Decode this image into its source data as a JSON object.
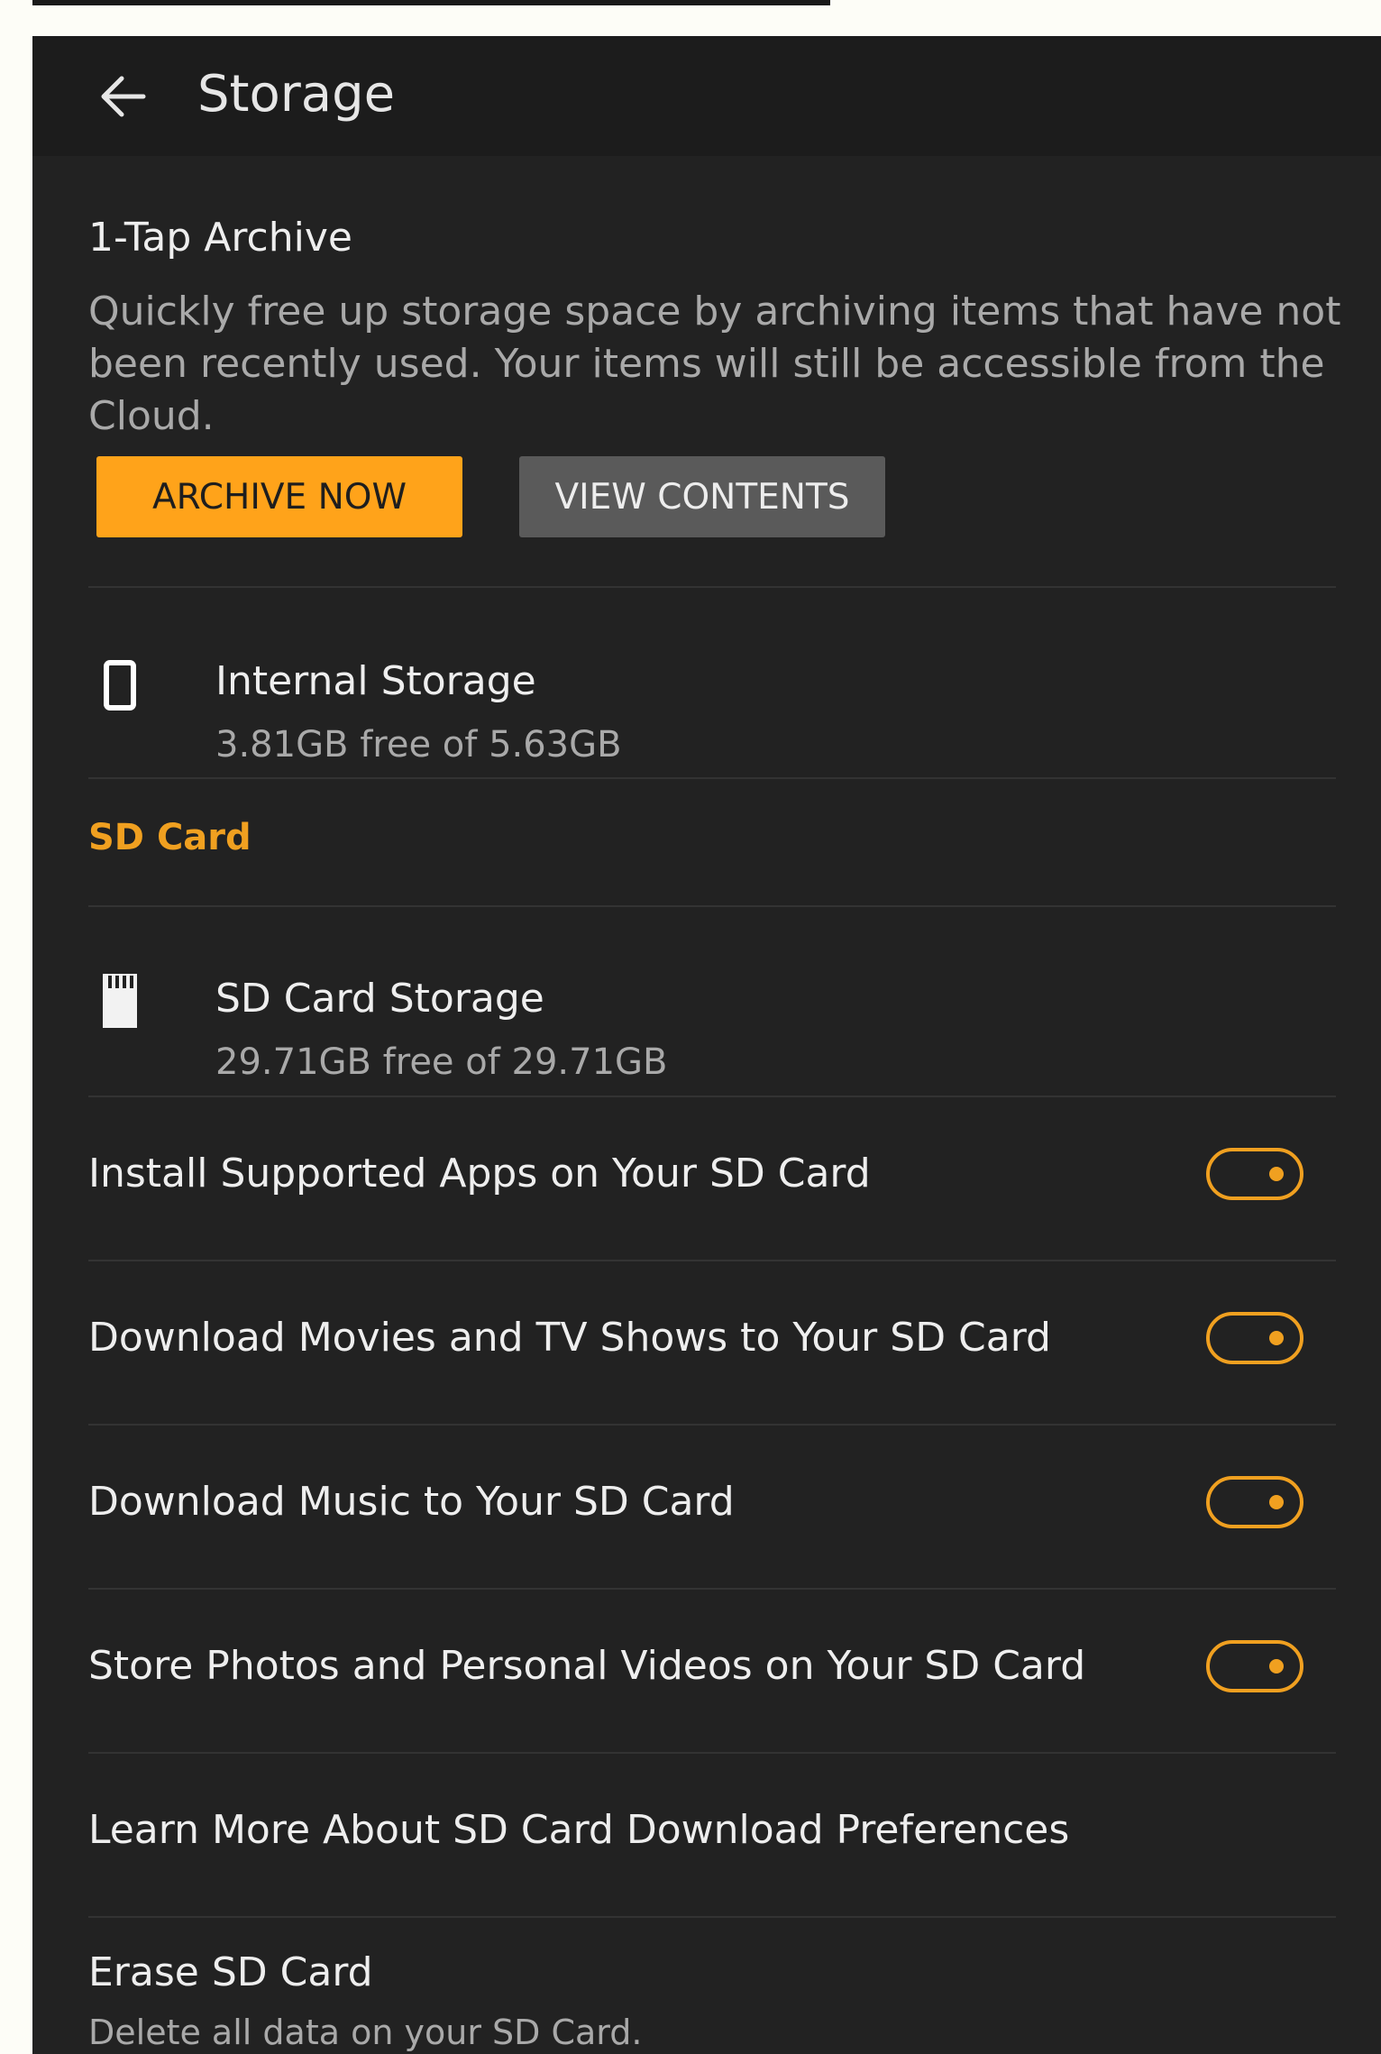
{
  "header": {
    "title": "Storage"
  },
  "archive": {
    "title": "1-Tap Archive",
    "description": "Quickly free up storage space by archiving items that have not been recently used. Your items will still be accessible from the Cloud.",
    "archive_button": "ARCHIVE NOW",
    "view_button": "VIEW CONTENTS"
  },
  "internal_storage": {
    "icon": "phone-icon",
    "title": "Internal Storage",
    "subtitle": "3.81GB free of 5.63GB"
  },
  "sd_card_section": {
    "label": "SD Card"
  },
  "sd_storage": {
    "icon": "sd-card-icon",
    "title": "SD Card Storage",
    "subtitle": "29.71GB free of 29.71GB"
  },
  "toggles": [
    {
      "label": "Install Supported Apps on Your SD Card",
      "state": "on"
    },
    {
      "label": "Download Movies and TV Shows to Your SD Card",
      "state": "on"
    },
    {
      "label": "Download Music to Your SD Card",
      "state": "on"
    },
    {
      "label": "Store Photos and Personal Videos on Your SD Card",
      "state": "on"
    }
  ],
  "learn_more": {
    "label": "Learn More About SD Card Download Preferences"
  },
  "erase": {
    "title": "Erase SD Card",
    "subtitle": "Delete all data on your SD Card."
  },
  "colors": {
    "background": "#222222",
    "accent": "#f0a020",
    "archive_button": "#ffa31a",
    "secondary_button": "#5a5a5a"
  }
}
